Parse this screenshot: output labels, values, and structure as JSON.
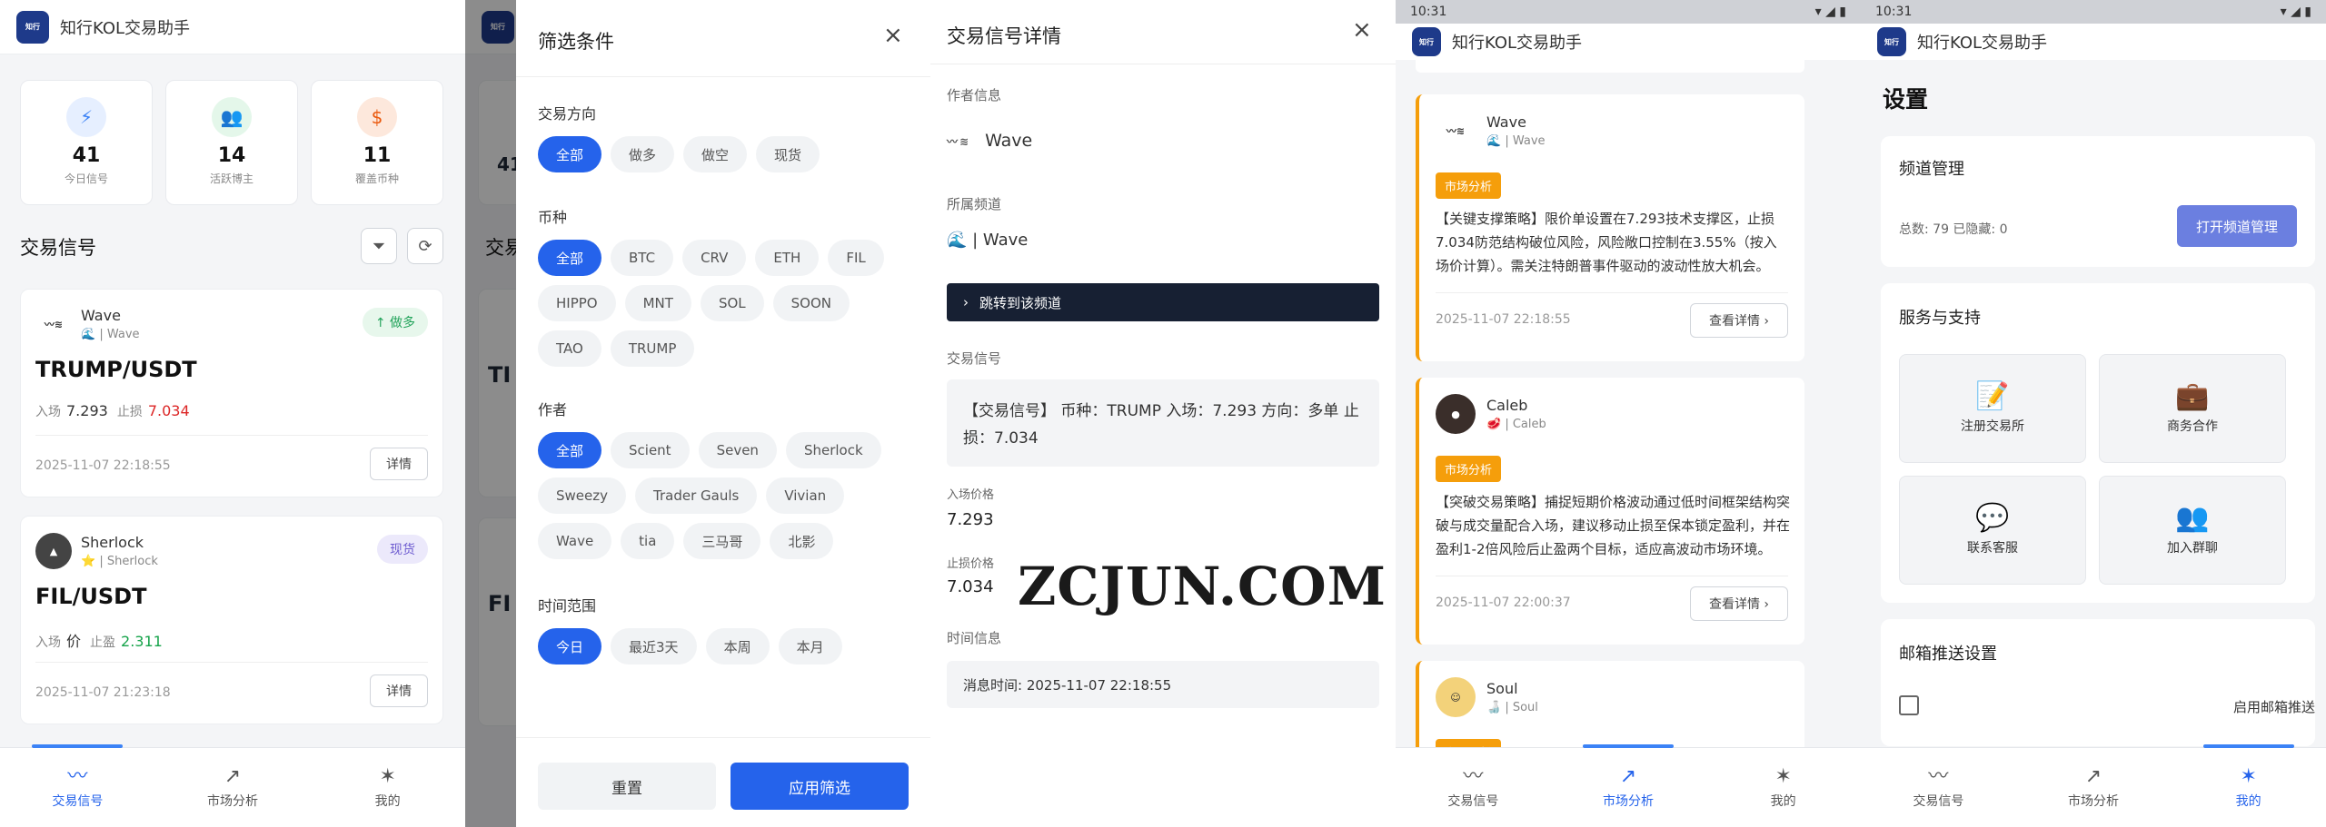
{
  "app_title": "知行KOL交易助手",
  "logo_text": "知行",
  "nav": {
    "signals": "交易信号",
    "market": "市场分析",
    "mine": "我的"
  },
  "screen1": {
    "stats": [
      {
        "num": "41",
        "label": "今日信号",
        "icon": "⚡",
        "color": "#e6efff",
        "fg": "#3b82f6"
      },
      {
        "num": "14",
        "label": "活跃博主",
        "icon": "👥",
        "color": "#e4f7ea",
        "fg": "#16a34a"
      },
      {
        "num": "11",
        "label": "覆盖币种",
        "icon": "$",
        "color": "#fde8dc",
        "fg": "#ea580c"
      }
    ],
    "section_title": "交易信号",
    "cards": [
      {
        "author": "Wave",
        "channel": "🌊 | Wave",
        "badge": "↑ 做多",
        "pair": "TRUMP/USDT",
        "entry_label": "入场",
        "entry": "7.293",
        "stop_label": "止损",
        "stop": "7.034",
        "time": "2025-11-07 22:18:55",
        "detail": "详情"
      },
      {
        "author": "Sherlock",
        "channel": "⭐ | Sherlock",
        "badge": "现货",
        "pair": "FIL/USDT",
        "entry_label": "入场",
        "entry": "价",
        "stop_label": "止盈",
        "stop": "2.311",
        "time": "2025-11-07 21:23:18",
        "detail": "详情"
      }
    ]
  },
  "screen2": {
    "bg_cards": [
      "TI",
      "FI"
    ],
    "bg_num": "41",
    "bg_title": "交易",
    "title": "筛选条件",
    "dir_label": "交易方向",
    "dirs": [
      "全部",
      "做多",
      "做空",
      "现货"
    ],
    "coin_label": "币种",
    "coins": [
      "全部",
      "BTC",
      "CRV",
      "ETH",
      "FIL",
      "HIPPO",
      "MNT",
      "SOL",
      "SOON",
      "TAO",
      "TRUMP"
    ],
    "author_label": "作者",
    "authors": [
      "全部",
      "Scient",
      "Seven",
      "Sherlock",
      "Sweezy",
      "Trader Gauls",
      "Vivian",
      "Wave",
      "tia",
      "三马哥",
      "北影"
    ],
    "time_label": "时间范围",
    "times": [
      "今日",
      "最近3天",
      "本周",
      "本月"
    ],
    "reset": "重置",
    "apply": "应用筛选"
  },
  "screen3": {
    "title": "交易信号详情",
    "author_label": "作者信息",
    "author": "Wave",
    "channel_label": "所属频道",
    "channel": "🌊 | Wave",
    "jump": "跳转到该频道",
    "signal_label": "交易信号",
    "signal_text": "【交易信号】 币种：TRUMP 入场：7.293 方向：多单 止损：7.034",
    "entry_label": "入场价格",
    "entry": "7.293",
    "stop_label": "止损价格",
    "stop": "7.034",
    "time_label": "时间信息",
    "msg_time": "消息时间:  2025-11-07 22:18:55"
  },
  "screen4": {
    "status_time": "10:31",
    "tag": "市场分析",
    "view": "查看详情 ›",
    "cards": [
      {
        "author": "Wave",
        "channel": "🌊 | Wave",
        "text": "【关键支撑策略】限价单设置在7.293技术支撑区，止损7.034防范结构破位风险，风险敞口控制在3.55%（按入场价计算）。需关注特朗普事件驱动的波动性放大机会。",
        "time": "2025-11-07 22:18:55"
      },
      {
        "author": "Caleb",
        "channel": "🥩 | Caleb",
        "text": "【突破交易策略】捕捉短期价格波动通过低时间框架结构突破与成交量配合入场，建议移动止损至保本锁定盈利，并在盈利1-2倍风险后止盈两个目标，适应高波动市场环境。",
        "time": "2025-11-07 22:00:37"
      },
      {
        "author": "Soul",
        "channel": "🍶 | Soul",
        "text": "",
        "time": ""
      }
    ]
  },
  "screen5": {
    "status_time": "10:31",
    "title": "设置",
    "channel_mgmt": "频道管理",
    "counts": "总数: 79   已隐藏: 0",
    "open_mgmt": "打开频道管理",
    "service": "服务与支持",
    "tiles": [
      {
        "icon": "📝",
        "label": "注册交易所"
      },
      {
        "icon": "💼",
        "label": "商务合作"
      },
      {
        "icon": "💬",
        "label": "联系客服"
      },
      {
        "icon": "👥",
        "label": "加入群聊"
      }
    ],
    "email_title": "邮箱推送设置",
    "email_toggle": "启用邮箱推送"
  },
  "watermark": "ZCJUN.COM"
}
